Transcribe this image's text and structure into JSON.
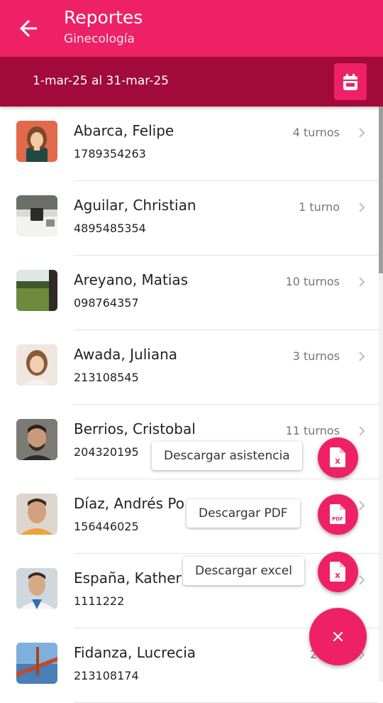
{
  "header": {
    "title": "Reportes",
    "subtitle": "Ginecología"
  },
  "date_range": "1-mar-25 al 31-mar-25",
  "patients": [
    {
      "name": "Abarca, Felipe",
      "phone": "1789354263",
      "turnos": "4 turnos"
    },
    {
      "name": "Aguilar, Christian",
      "phone": "4895485354",
      "turnos": "1 turno"
    },
    {
      "name": "Areyano, Matias",
      "phone": "098764357",
      "turnos": "10 turnos"
    },
    {
      "name": "Awada, Juliana",
      "phone": "213108545",
      "turnos": "3 turnos"
    },
    {
      "name": "Berrios, Cristobal",
      "phone": "204320195",
      "turnos": "11 turnos"
    },
    {
      "name": "Díaz, Andrés Po",
      "phone": "156446025",
      "turnos": ""
    },
    {
      "name": "España, Kather",
      "phone": "1111222",
      "turnos": ""
    },
    {
      "name": "Fidanza, Lucrecia",
      "phone": "213108174",
      "turnos": "28 tu"
    }
  ],
  "actions": {
    "asistencia": "Descargar asistencia",
    "pdf": "Descargar PDF",
    "excel": "Descargar excel",
    "pdf_icon_text": "PDF",
    "excel_icon_text": "X"
  },
  "colors": {
    "primary": "#ee2166",
    "dark": "#a10a3b"
  }
}
